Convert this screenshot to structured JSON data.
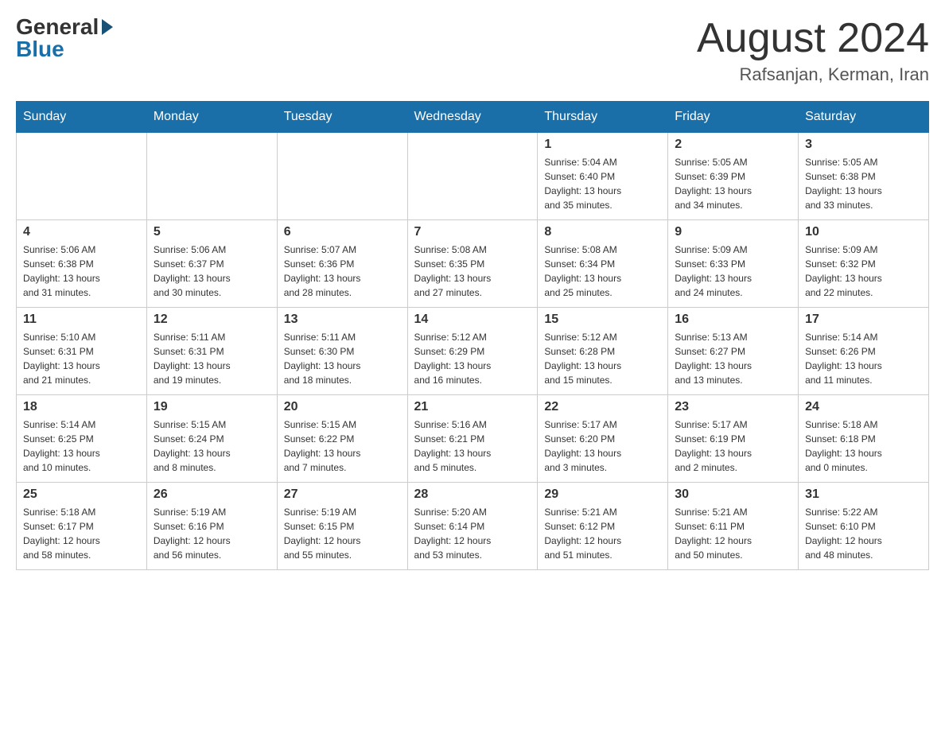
{
  "header": {
    "logo_general": "General",
    "logo_blue": "Blue",
    "month_title": "August 2024",
    "subtitle": "Rafsanjan, Kerman, Iran"
  },
  "days_of_week": [
    "Sunday",
    "Monday",
    "Tuesday",
    "Wednesday",
    "Thursday",
    "Friday",
    "Saturday"
  ],
  "weeks": [
    [
      {
        "day": "",
        "info": ""
      },
      {
        "day": "",
        "info": ""
      },
      {
        "day": "",
        "info": ""
      },
      {
        "day": "",
        "info": ""
      },
      {
        "day": "1",
        "info": "Sunrise: 5:04 AM\nSunset: 6:40 PM\nDaylight: 13 hours\nand 35 minutes."
      },
      {
        "day": "2",
        "info": "Sunrise: 5:05 AM\nSunset: 6:39 PM\nDaylight: 13 hours\nand 34 minutes."
      },
      {
        "day": "3",
        "info": "Sunrise: 5:05 AM\nSunset: 6:38 PM\nDaylight: 13 hours\nand 33 minutes."
      }
    ],
    [
      {
        "day": "4",
        "info": "Sunrise: 5:06 AM\nSunset: 6:38 PM\nDaylight: 13 hours\nand 31 minutes."
      },
      {
        "day": "5",
        "info": "Sunrise: 5:06 AM\nSunset: 6:37 PM\nDaylight: 13 hours\nand 30 minutes."
      },
      {
        "day": "6",
        "info": "Sunrise: 5:07 AM\nSunset: 6:36 PM\nDaylight: 13 hours\nand 28 minutes."
      },
      {
        "day": "7",
        "info": "Sunrise: 5:08 AM\nSunset: 6:35 PM\nDaylight: 13 hours\nand 27 minutes."
      },
      {
        "day": "8",
        "info": "Sunrise: 5:08 AM\nSunset: 6:34 PM\nDaylight: 13 hours\nand 25 minutes."
      },
      {
        "day": "9",
        "info": "Sunrise: 5:09 AM\nSunset: 6:33 PM\nDaylight: 13 hours\nand 24 minutes."
      },
      {
        "day": "10",
        "info": "Sunrise: 5:09 AM\nSunset: 6:32 PM\nDaylight: 13 hours\nand 22 minutes."
      }
    ],
    [
      {
        "day": "11",
        "info": "Sunrise: 5:10 AM\nSunset: 6:31 PM\nDaylight: 13 hours\nand 21 minutes."
      },
      {
        "day": "12",
        "info": "Sunrise: 5:11 AM\nSunset: 6:31 PM\nDaylight: 13 hours\nand 19 minutes."
      },
      {
        "day": "13",
        "info": "Sunrise: 5:11 AM\nSunset: 6:30 PM\nDaylight: 13 hours\nand 18 minutes."
      },
      {
        "day": "14",
        "info": "Sunrise: 5:12 AM\nSunset: 6:29 PM\nDaylight: 13 hours\nand 16 minutes."
      },
      {
        "day": "15",
        "info": "Sunrise: 5:12 AM\nSunset: 6:28 PM\nDaylight: 13 hours\nand 15 minutes."
      },
      {
        "day": "16",
        "info": "Sunrise: 5:13 AM\nSunset: 6:27 PM\nDaylight: 13 hours\nand 13 minutes."
      },
      {
        "day": "17",
        "info": "Sunrise: 5:14 AM\nSunset: 6:26 PM\nDaylight: 13 hours\nand 11 minutes."
      }
    ],
    [
      {
        "day": "18",
        "info": "Sunrise: 5:14 AM\nSunset: 6:25 PM\nDaylight: 13 hours\nand 10 minutes."
      },
      {
        "day": "19",
        "info": "Sunrise: 5:15 AM\nSunset: 6:24 PM\nDaylight: 13 hours\nand 8 minutes."
      },
      {
        "day": "20",
        "info": "Sunrise: 5:15 AM\nSunset: 6:22 PM\nDaylight: 13 hours\nand 7 minutes."
      },
      {
        "day": "21",
        "info": "Sunrise: 5:16 AM\nSunset: 6:21 PM\nDaylight: 13 hours\nand 5 minutes."
      },
      {
        "day": "22",
        "info": "Sunrise: 5:17 AM\nSunset: 6:20 PM\nDaylight: 13 hours\nand 3 minutes."
      },
      {
        "day": "23",
        "info": "Sunrise: 5:17 AM\nSunset: 6:19 PM\nDaylight: 13 hours\nand 2 minutes."
      },
      {
        "day": "24",
        "info": "Sunrise: 5:18 AM\nSunset: 6:18 PM\nDaylight: 13 hours\nand 0 minutes."
      }
    ],
    [
      {
        "day": "25",
        "info": "Sunrise: 5:18 AM\nSunset: 6:17 PM\nDaylight: 12 hours\nand 58 minutes."
      },
      {
        "day": "26",
        "info": "Sunrise: 5:19 AM\nSunset: 6:16 PM\nDaylight: 12 hours\nand 56 minutes."
      },
      {
        "day": "27",
        "info": "Sunrise: 5:19 AM\nSunset: 6:15 PM\nDaylight: 12 hours\nand 55 minutes."
      },
      {
        "day": "28",
        "info": "Sunrise: 5:20 AM\nSunset: 6:14 PM\nDaylight: 12 hours\nand 53 minutes."
      },
      {
        "day": "29",
        "info": "Sunrise: 5:21 AM\nSunset: 6:12 PM\nDaylight: 12 hours\nand 51 minutes."
      },
      {
        "day": "30",
        "info": "Sunrise: 5:21 AM\nSunset: 6:11 PM\nDaylight: 12 hours\nand 50 minutes."
      },
      {
        "day": "31",
        "info": "Sunrise: 5:22 AM\nSunset: 6:10 PM\nDaylight: 12 hours\nand 48 minutes."
      }
    ]
  ]
}
